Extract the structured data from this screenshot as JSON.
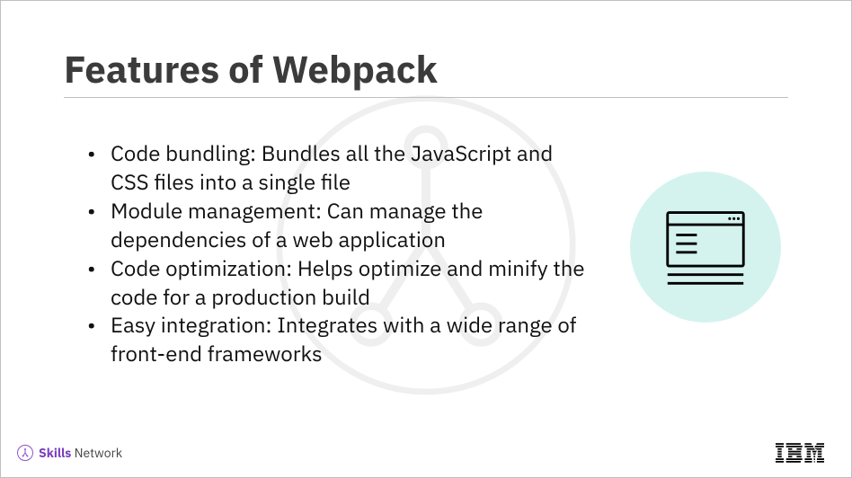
{
  "title": "Features of Webpack",
  "bullets": [
    "Code bundling: Bundles all the JavaScript and CSS files into a single file",
    "Module management: Can manage the dependencies of a web application",
    "Code optimization: Helps optimize and minify the code for a production build",
    "Easy integration: Integrates with a wide range of front-end frameworks"
  ],
  "footer": {
    "skills": "Skills",
    "network": "Network",
    "company": "IBM"
  }
}
